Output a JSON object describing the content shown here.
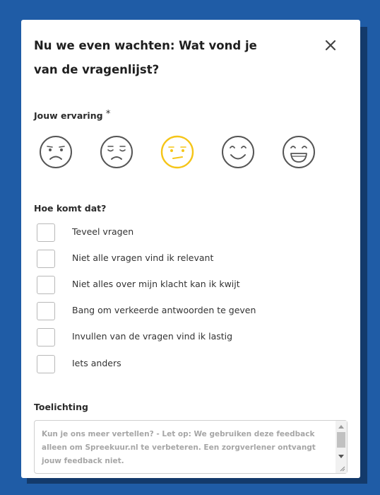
{
  "dialog": {
    "title": "Nu we even wachten: Wat vond je van de vragenlijst?",
    "close_icon": "close-icon"
  },
  "experience": {
    "label": "Jouw ervaring",
    "required_mark": "*",
    "faces": [
      {
        "icon": "very-unhappy-face-icon"
      },
      {
        "icon": "sad-face-icon"
      },
      {
        "icon": "neutral-face-icon",
        "selected": true,
        "color": "#f5c518"
      },
      {
        "icon": "happy-face-icon"
      },
      {
        "icon": "very-happy-face-icon"
      }
    ]
  },
  "reason": {
    "label": "Hoe komt dat?",
    "options": [
      "Teveel vragen",
      "Niet alle vragen vind ik relevant",
      "Niet alles over mijn klacht kan ik kwijt",
      "Bang om verkeerde antwoorden te geven",
      "Invullen van de vragen vind ik lastig",
      "Iets anders"
    ]
  },
  "comment": {
    "label": "Toelichting",
    "placeholder": "Kun je ons meer vertellen? - Let op: We gebruiken deze feedback alleen om Spreekuur.nl te verbeteren. Een zorgverlener ontvangt jouw feedback niet."
  },
  "colors": {
    "background": "#1f5ca6",
    "selected_face": "#f5c518",
    "face_default": "#555555"
  }
}
